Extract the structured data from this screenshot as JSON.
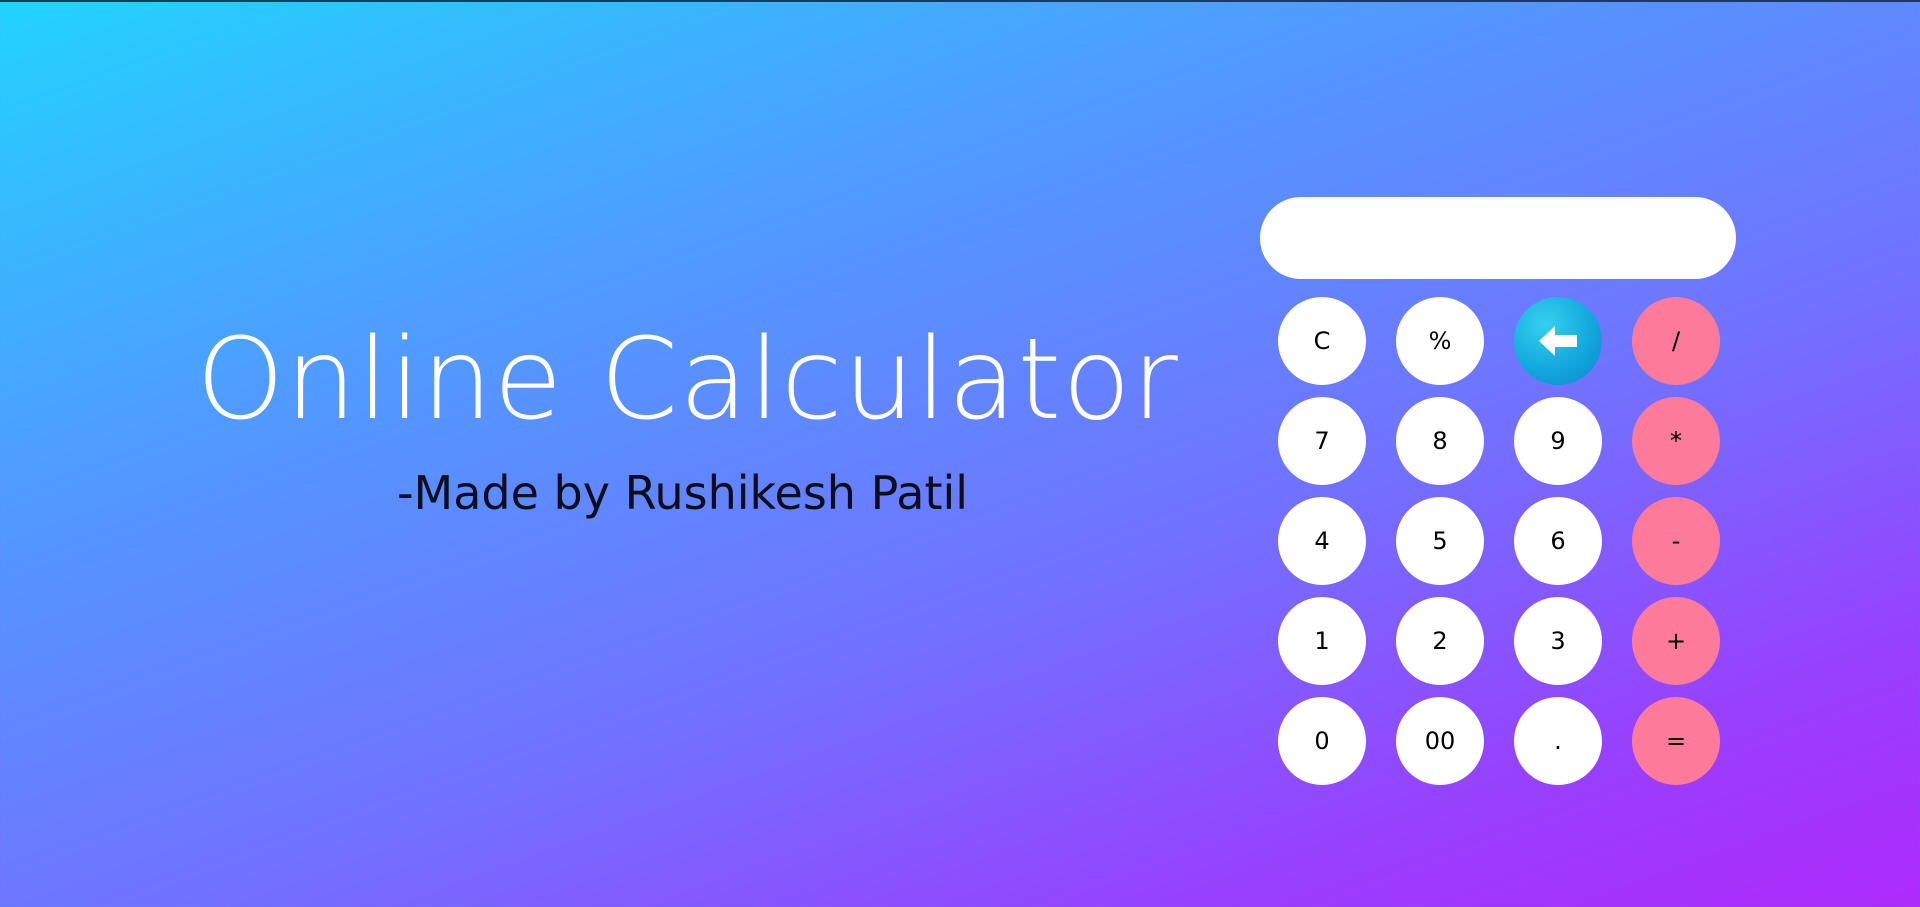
{
  "hero": {
    "title": "Online Calculator",
    "subtitle": "-Made by Rushikesh Patil"
  },
  "calculator": {
    "display_value": "",
    "keys": [
      {
        "label": "C",
        "type": "function"
      },
      {
        "label": "%",
        "type": "function"
      },
      {
        "label": "",
        "type": "backspace",
        "icon": "arrow-left-icon"
      },
      {
        "label": "/",
        "type": "operator"
      },
      {
        "label": "7",
        "type": "digit"
      },
      {
        "label": "8",
        "type": "digit"
      },
      {
        "label": "9",
        "type": "digit"
      },
      {
        "label": "*",
        "type": "operator"
      },
      {
        "label": "4",
        "type": "digit"
      },
      {
        "label": "5",
        "type": "digit"
      },
      {
        "label": "6",
        "type": "digit"
      },
      {
        "label": "-",
        "type": "operator"
      },
      {
        "label": "1",
        "type": "digit"
      },
      {
        "label": "2",
        "type": "digit"
      },
      {
        "label": "3",
        "type": "digit"
      },
      {
        "label": "+",
        "type": "operator"
      },
      {
        "label": "0",
        "type": "digit"
      },
      {
        "label": "00",
        "type": "digit"
      },
      {
        "label": ".",
        "type": "digit"
      },
      {
        "label": "=",
        "type": "operator"
      }
    ]
  },
  "colors": {
    "background_start": "#22d3fe",
    "background_end": "#ae2bfc",
    "operator_key": "#fe7a9b",
    "backspace_key": "#13a8de",
    "number_key": "#ffffff"
  }
}
